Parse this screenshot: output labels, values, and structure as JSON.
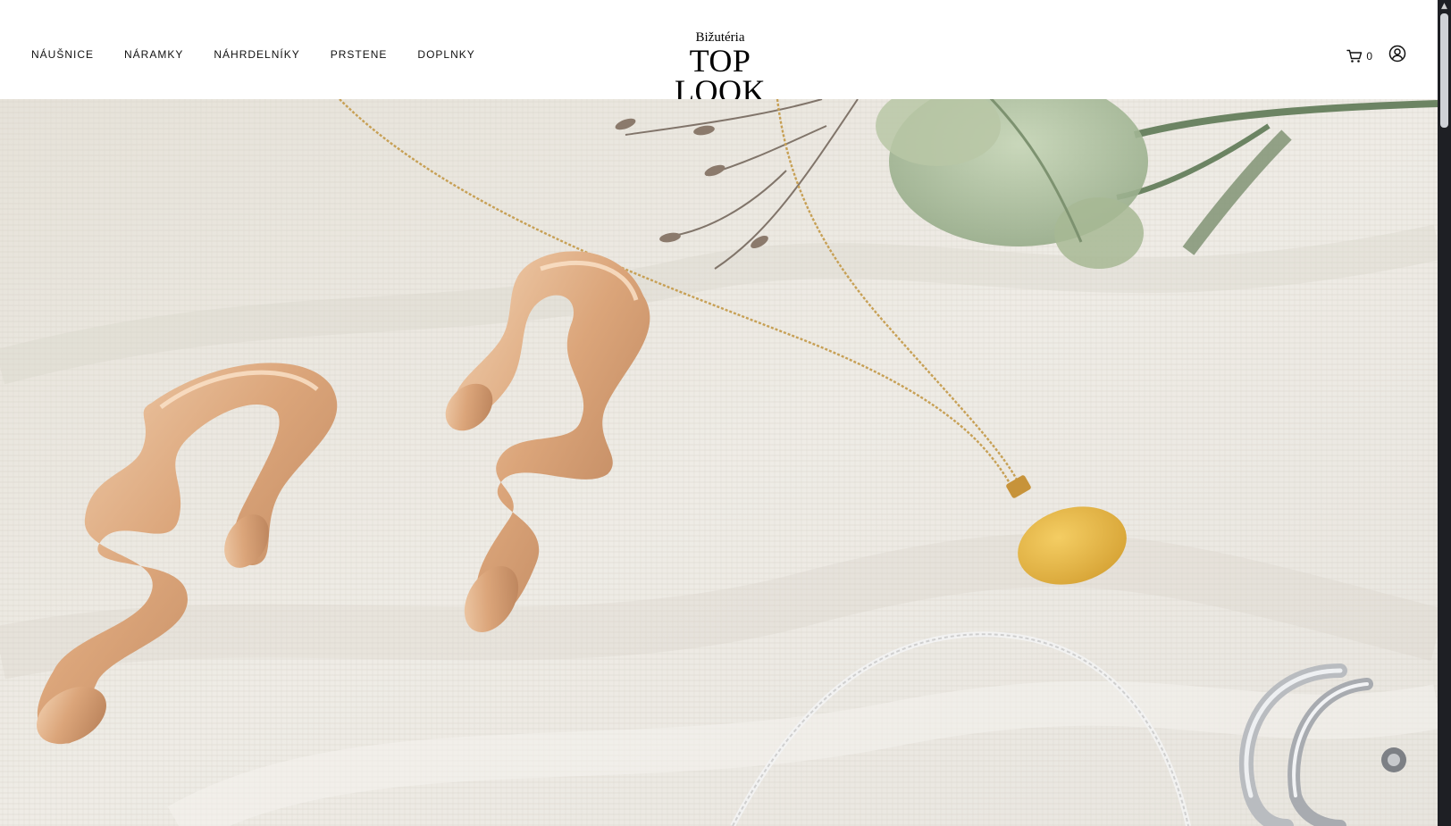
{
  "nav": {
    "items": [
      {
        "label": "NÁUŠNICE"
      },
      {
        "label": "NÁRAMKY"
      },
      {
        "label": "NÁHRDELNÍKY"
      },
      {
        "label": "PRSTENE"
      },
      {
        "label": "DOPLNKY"
      }
    ]
  },
  "logo": {
    "small": "Bižutéria",
    "big": "TOP LOOK"
  },
  "cart": {
    "count": "0",
    "icon": "cart-icon"
  },
  "account": {
    "icon": "user-icon"
  },
  "hero": {
    "image": "jewelry-hero-image"
  },
  "colors": {
    "background": "#ffffff",
    "text": "#111111",
    "fabric": "#ece9e2",
    "gold": "#d9ad7c",
    "scrollbar": "#1e1f24"
  }
}
